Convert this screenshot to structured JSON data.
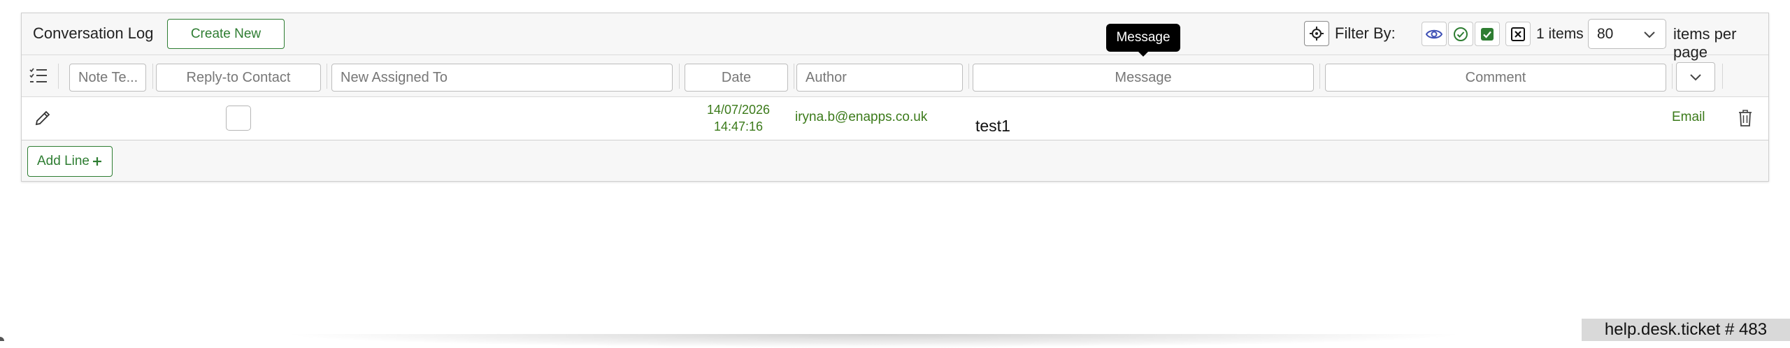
{
  "header": {
    "title": "Conversation Log",
    "create_new_label": "Create New",
    "filter_label": "Filter By:",
    "items_count": "1 items",
    "per_page_value": "80",
    "per_page_label": "items per page"
  },
  "tooltip": {
    "text": "Message"
  },
  "columns": {
    "note_type_placeholder": "Note Te...",
    "reply_to_placeholder": "Reply-to Contact",
    "assigned_to_placeholder": "New Assigned To",
    "date_placeholder": "Date",
    "author_placeholder": "Author",
    "message_placeholder": "Message",
    "comment_placeholder": "Comment"
  },
  "rows": [
    {
      "date": "14/07/2026",
      "time": "14:47:16",
      "author": "iryna.b@enapps.co.uk",
      "message": "test1",
      "type": "Email"
    }
  ],
  "footer": {
    "add_line_label": "Add Line"
  },
  "status_badge": "help.desk.ticket # 483",
  "colors": {
    "accent_green": "#2e7d32",
    "text_green": "#3b7a1a",
    "eye_blue": "#3f51b5"
  },
  "icons": [
    "target-icon",
    "eye-icon",
    "check-circle-icon",
    "checked-box-icon",
    "x-box-icon",
    "chevron-down-icon",
    "list-settings-icon",
    "pencil-icon",
    "trash-icon",
    "plus-icon"
  ]
}
